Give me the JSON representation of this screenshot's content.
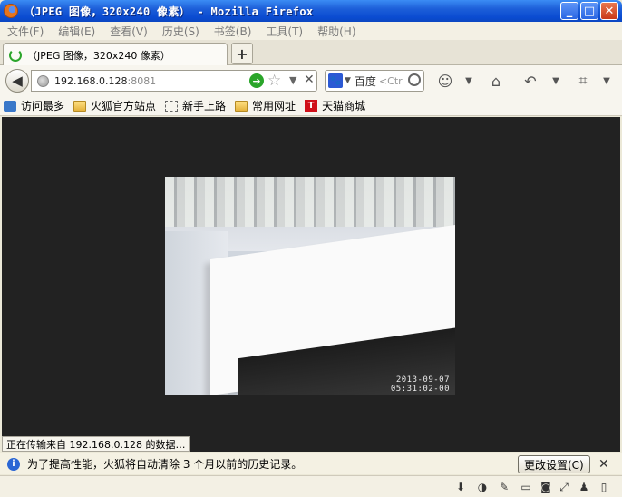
{
  "window": {
    "title": "（JPEG 图像，320x240 像素） - Mozilla Firefox",
    "buttons": {
      "minimize": "_",
      "maximize": "□",
      "close": "✕"
    }
  },
  "menubar": {
    "items": [
      "文件(F)",
      "编辑(E)",
      "查看(V)",
      "历史(S)",
      "书签(B)",
      "工具(T)",
      "帮助(H)"
    ]
  },
  "tabs": {
    "active_label": "（JPEG 图像，320x240 像素）",
    "new_tab_label": "+"
  },
  "navbar": {
    "back_icon": "back-arrow-icon",
    "url_host": "192.168.0.128",
    "url_port": ":8081",
    "search_engine": "百度",
    "search_placeholder": "<Ctr"
  },
  "bookmarks": {
    "items": [
      "访问最多",
      "火狐官方站点",
      "新手上路",
      "常用网址",
      "天猫商城"
    ]
  },
  "camera": {
    "date": "2013-09-07",
    "time": "05:31:02-00"
  },
  "status": {
    "text": "正在传输来自 192.168.0.128 的数据…"
  },
  "notice": {
    "text": "为了提高性能，火狐将自动清除 3 个月以前的历史记录。",
    "button": "更改设置(C)",
    "close": "✕"
  },
  "colors": {
    "titlebar": "#0a4bd1",
    "content_bg": "#222222",
    "notice_bg": "#f4f1e3"
  }
}
